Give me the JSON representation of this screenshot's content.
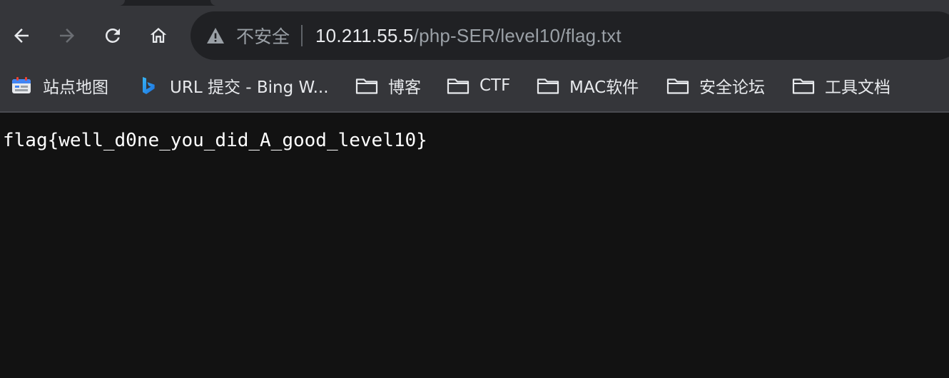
{
  "toolbar": {
    "back_icon": "arrow-left-icon",
    "forward_icon": "arrow-right-icon",
    "reload_icon": "reload-icon",
    "home_icon": "home-icon"
  },
  "omnibox": {
    "security_icon": "warning-triangle-icon",
    "security_label": "不安全",
    "url_host": "10.211.55.5",
    "url_path": "/php-SER/level10/flag.txt"
  },
  "bookmarks": [
    {
      "icon": "site-map-icon",
      "label": "站点地图"
    },
    {
      "icon": "bing-icon",
      "label": "URL 提交 - Bing W..."
    },
    {
      "icon": "folder-icon",
      "label": "博客"
    },
    {
      "icon": "folder-icon",
      "label": "CTF"
    },
    {
      "icon": "folder-icon",
      "label": "MAC软件"
    },
    {
      "icon": "folder-icon",
      "label": "安全论坛"
    },
    {
      "icon": "folder-icon",
      "label": "工具文档"
    }
  ],
  "page": {
    "content": "flag{well_d0ne_you_did_A_good_level10}"
  },
  "colors": {
    "chrome_bg": "#35363a",
    "omnibox_bg": "#202124",
    "page_bg": "#121212",
    "text_primary": "#e8eaed",
    "text_secondary": "#9aa0a6"
  }
}
